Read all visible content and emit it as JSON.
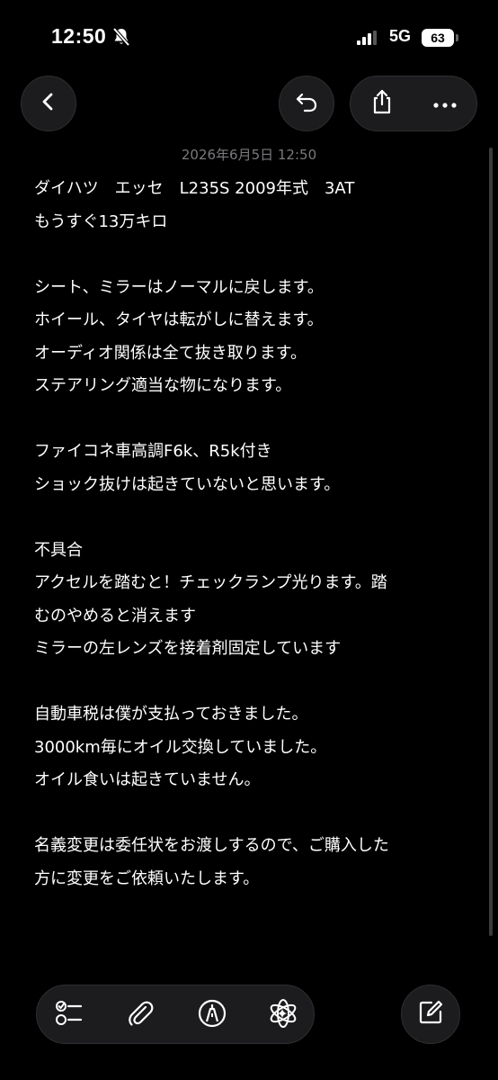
{
  "status_bar": {
    "time": "12:50",
    "network": "5G",
    "battery": "63"
  },
  "icons": {
    "mute": "bell-slash-icon",
    "signal": "cellular-signal-icon",
    "back": "chevron-left-icon",
    "undo": "undo-arrow-icon",
    "share": "share-icon",
    "more": "ellipsis-icon",
    "checklist": "checklist-icon",
    "attach": "paperclip-icon",
    "markup": "pen-markup-icon",
    "ai": "writing-tools-icon",
    "compose": "compose-icon"
  },
  "note": {
    "timestamp": "2026年6月5日 12:50",
    "lines": [
      "ダイハツ　エッセ　L235S 2009年式　3AT",
      "もうすぐ13万キロ",
      "",
      "シート、ミラーはノーマルに戻します。",
      "ホイール、タイヤは転がしに替えます。",
      "オーディオ関係は全て抜き取ります。",
      "ステアリング適当な物になります。",
      "",
      "ファイコネ車高調F6k、R5k付き",
      "ショック抜けは起きていないと思います。",
      "",
      "不具合",
      "アクセルを踏むと！チェックランプ光ります。踏",
      "むのやめると消えます",
      "ミラーの左レンズを接着剤固定しています",
      "",
      "自動車税は僕が支払っておきました。",
      "3000km毎にオイル交換していました。",
      "オイル食いは起きていません。",
      "",
      "名義変更は委任状をお渡しするので、ご購入した",
      "方に変更をご依頼いたします。"
    ]
  },
  "colors": {
    "background": "#000000",
    "button_bg": "#1c1c1e",
    "timestamp": "#7a7a7e",
    "text": "#ffffff"
  }
}
